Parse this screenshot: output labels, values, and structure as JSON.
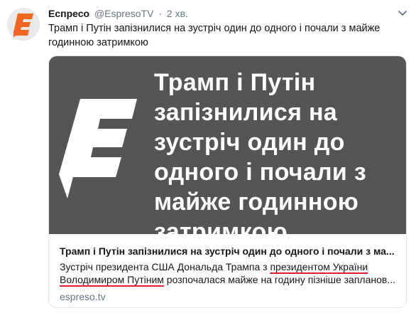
{
  "tweet": {
    "author_name": "Еспресо",
    "handle": "@EspresoTV",
    "separator": "·",
    "time": "2 хв.",
    "text": "Трамп і Путін запізнилися на зустріч один до одного і почали з майже годинною затримкою"
  },
  "card": {
    "image_headline": "Трамп і Путін запізнилися на зустріч один до одного і почали з майже годинною затримкою",
    "title": "Трамп і Путін запізнилися на зустріч один до одного і почали з ма...",
    "desc_part1": "Зустріч президента США Дональда Трампа з ",
    "desc_highlight": "президентом України Володимиром Путіним",
    "desc_part2": " розпочалася майже на годину пізніше запланов...",
    "url": "espreso.tv"
  },
  "colors": {
    "brand_orange": "#f26522",
    "card_image_bg": "#555555",
    "underline_red": "#e0202c",
    "muted": "#657786"
  },
  "icons": {
    "avatar": "espreso-logo-icon",
    "menu": "chevron-down-icon"
  }
}
